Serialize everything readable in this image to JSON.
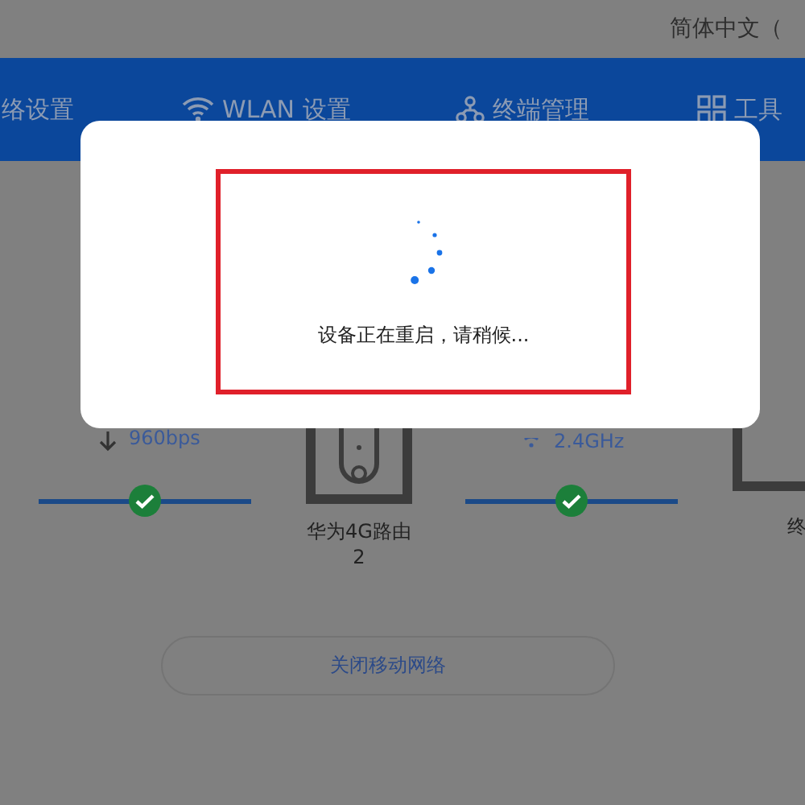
{
  "header": {
    "language": "简体中文（"
  },
  "nav_tabs": [
    {
      "label": "络设置"
    },
    {
      "label": "WLAN 设置"
    },
    {
      "label": "终端管理"
    },
    {
      "label": "工具"
    }
  ],
  "topology": {
    "download_speed": "960bps",
    "device_name": "华为4G路由\n2",
    "wlan_band": "2.4GHz",
    "client_label": "终",
    "links": [
      {
        "connected": true
      },
      {
        "connected": true
      }
    ]
  },
  "modal": {
    "message": "设备正在重启，请稍候..."
  },
  "action_button": "关闭移动网络"
}
